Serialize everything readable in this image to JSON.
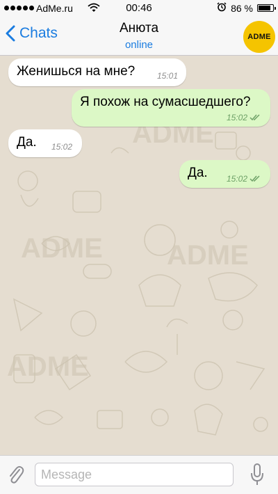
{
  "status_bar": {
    "carrier": "AdMe.ru",
    "time": "00:46",
    "battery_percent": "86 %",
    "battery_level": 0.86,
    "icons": [
      "signal-dots-icon",
      "wifi-icon",
      "alarm-icon",
      "battery-icon"
    ]
  },
  "nav": {
    "back_label": "Chats",
    "contact_name": "Анюта",
    "contact_status": "online",
    "avatar_text": "ADME",
    "avatar_color": "#f5c400",
    "accent_color": "#1a7ce0"
  },
  "messages": [
    {
      "direction": "incoming",
      "text": "Женишься на мне?",
      "time": "15:01"
    },
    {
      "direction": "outgoing",
      "text": "Я похож на сумасшедшего?",
      "time": "15:02",
      "status": "read"
    },
    {
      "direction": "incoming",
      "text": "Да.",
      "time": "15:02"
    },
    {
      "direction": "outgoing",
      "text": "Да.",
      "time": "15:02",
      "status": "read"
    }
  ],
  "wallpaper_watermark": "ADME",
  "colors": {
    "incoming_bubble": "#ffffff",
    "outgoing_bubble": "#dcf8c6",
    "chat_background": "#e5ddd0"
  },
  "input": {
    "placeholder": "Message",
    "value": "",
    "icons": [
      "paperclip-icon",
      "microphone-icon"
    ]
  }
}
